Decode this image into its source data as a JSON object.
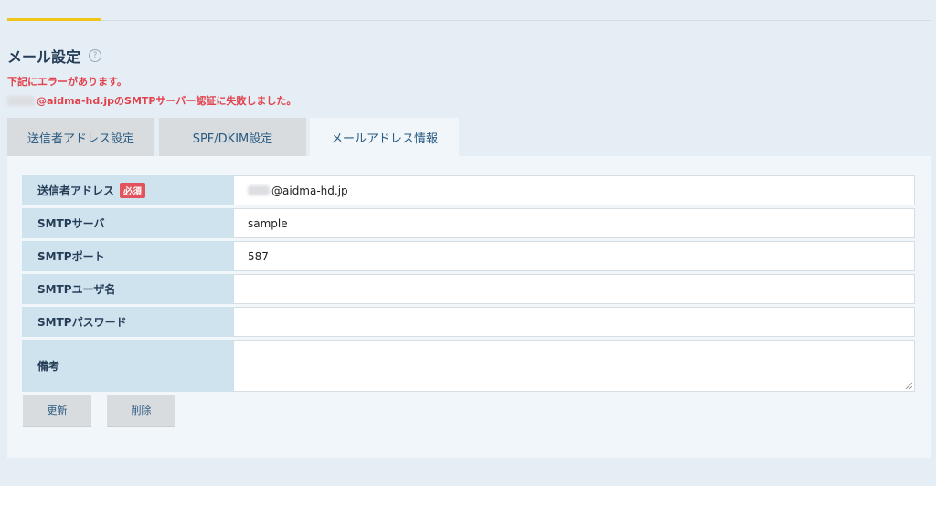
{
  "page": {
    "title": "メール設定",
    "help_icon": "?"
  },
  "errors": {
    "line1": "下記にエラーがあります。",
    "line2": "@aidma-hd.jpのSMTPサーバー認証に失敗しました。"
  },
  "tabs": [
    {
      "label": "送信者アドレス設定",
      "active": false
    },
    {
      "label": "SPF/DKIM設定",
      "active": false
    },
    {
      "label": "メールアドレス情報",
      "active": true
    }
  ],
  "form": {
    "sender_address": {
      "label": "送信者アドレス",
      "badge": "必須",
      "value": "@aidma-hd.jp"
    },
    "smtp_server": {
      "label": "SMTPサーバ",
      "value": "sample"
    },
    "smtp_port": {
      "label": "SMTPポート",
      "value": "587"
    },
    "smtp_username": {
      "label": "SMTPユーザ名",
      "value": ""
    },
    "smtp_password": {
      "label": "SMTPパスワード",
      "value": ""
    },
    "notes": {
      "label": "備考",
      "value": ""
    }
  },
  "buttons": {
    "update": "更新",
    "delete": "削除"
  },
  "colors": {
    "error": "#e2404b",
    "label_bg": "#cfe3ee",
    "accent": "#f0c419",
    "badge": "#e2545c"
  }
}
